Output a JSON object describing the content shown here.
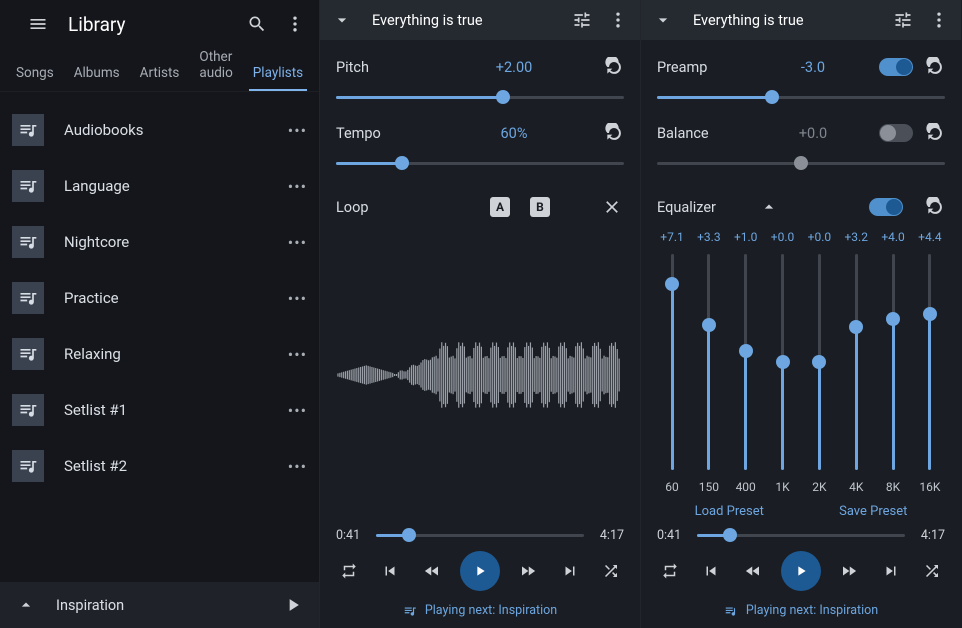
{
  "sidebar": {
    "title": "Library",
    "tabs": [
      "Songs",
      "Albums",
      "Artists",
      "Other audio",
      "Playlists"
    ],
    "active_tab_index": 4,
    "playlists": [
      "Audiobooks",
      "Language",
      "Nightcore",
      "Practice",
      "Relaxing",
      "Setlist #1",
      "Setlist #2"
    ],
    "now_playing": "Inspiration"
  },
  "panels": [
    {
      "track_title": "Everything is true",
      "controls": [
        {
          "label": "Pitch",
          "value": "+2.00",
          "pos": 0.58,
          "active": true
        },
        {
          "label": "Tempo",
          "value": "60%",
          "pos": 0.23,
          "active": true
        }
      ],
      "loop_label": "Loop",
      "progress": {
        "current": "0:41",
        "total": "4:17",
        "pos": 0.16
      },
      "playing_next": "Playing next: Inspiration"
    },
    {
      "track_title": "Everything is true",
      "controls": [
        {
          "label": "Preamp",
          "value": "-3.0",
          "pos": 0.4,
          "active": true,
          "toggle": true
        },
        {
          "label": "Balance",
          "value": "+0.0",
          "pos": 0.5,
          "active": false,
          "toggle": false
        }
      ],
      "equalizer": {
        "label": "Equalizer",
        "enabled": true,
        "bands": [
          {
            "freq": "60",
            "gain": "+7.1",
            "pos": 0.86
          },
          {
            "freq": "150",
            "gain": "+3.3",
            "pos": 0.67
          },
          {
            "freq": "400",
            "gain": "+1.0",
            "pos": 0.55
          },
          {
            "freq": "1K",
            "gain": "+0.0",
            "pos": 0.5
          },
          {
            "freq": "2K",
            "gain": "+0.0",
            "pos": 0.5
          },
          {
            "freq": "4K",
            "gain": "+3.2",
            "pos": 0.66
          },
          {
            "freq": "8K",
            "gain": "+4.0",
            "pos": 0.7
          },
          {
            "freq": "16K",
            "gain": "+4.4",
            "pos": 0.72
          }
        ],
        "load_preset": "Load Preset",
        "save_preset": "Save Preset"
      },
      "progress": {
        "current": "0:41",
        "total": "4:17",
        "pos": 0.16
      },
      "playing_next": "Playing next: Inspiration"
    }
  ]
}
